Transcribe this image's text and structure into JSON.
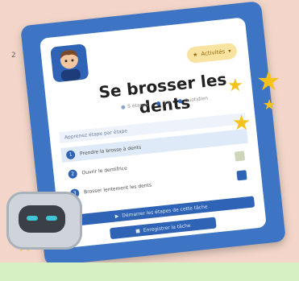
{
  "side_text": "2",
  "card": {
    "title": "Se brosser les dents",
    "badge_label": "Activités",
    "meta": [
      "5 étapes",
      "5 s",
      "Quotidien"
    ],
    "section_label": "Apprenez étape par étape",
    "steps": [
      {
        "num": "1",
        "label": "Prendre la brosse à dents"
      },
      {
        "num": "2",
        "label": "Ouvrir le dentifrice"
      },
      {
        "num": "3",
        "label": "Brosser lentement les dents"
      }
    ],
    "primary_button": "Démarrer les étapes de cette tâche",
    "secondary_button": "Enregistrer la tâche"
  },
  "colors": {
    "frame": "#3e74c4",
    "primary": "#2f63b5",
    "star": "#f5c21b",
    "background": "#f3d6c9"
  }
}
